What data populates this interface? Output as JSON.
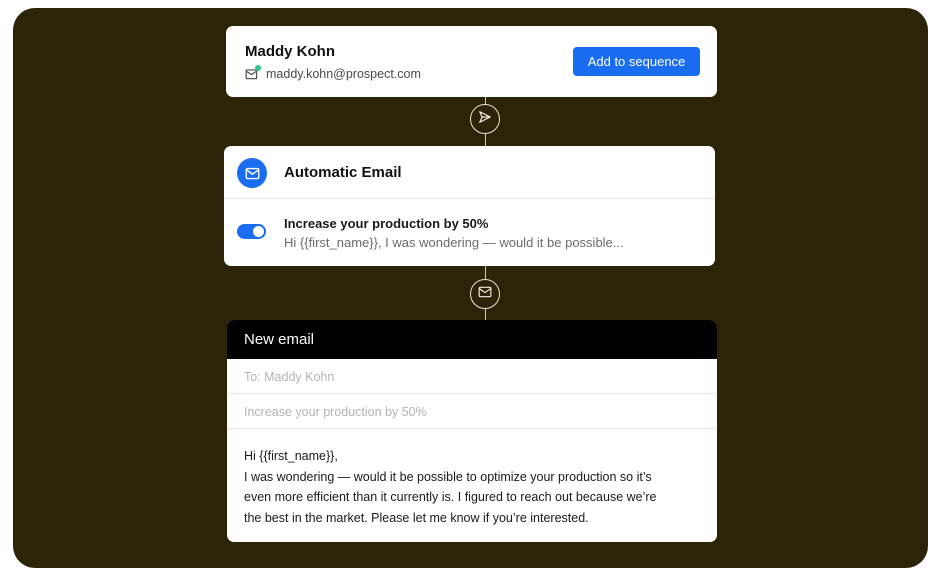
{
  "contact": {
    "name": "Maddy Kohn",
    "email": "maddy.kohn@prospect.com",
    "add_button_label": "Add to sequence"
  },
  "automatic_email": {
    "title": "Automatic Email",
    "subject": "Increase your production by 50%",
    "preview": "Hi {{first_name}},  I was wondering — would it be possible...",
    "enabled": true
  },
  "new_email": {
    "title": "New email",
    "to_value": "To: Maddy Kohn",
    "subject_value": "Increase your production by 50%",
    "body_lines": [
      "Hi {{first_name}},",
      "I was wondering — would it be possible to optimize your production so it’s",
      "even more efficient than it currently is. I figured to reach out because we’re",
      "the best in the market. Please let me know if you’re interested."
    ]
  },
  "icons": {
    "step_1": "send-icon",
    "step_2": "mail-icon"
  },
  "colors": {
    "background": "#2b2408",
    "accent": "#1a6cf0",
    "status_dot": "#2fc58c"
  }
}
